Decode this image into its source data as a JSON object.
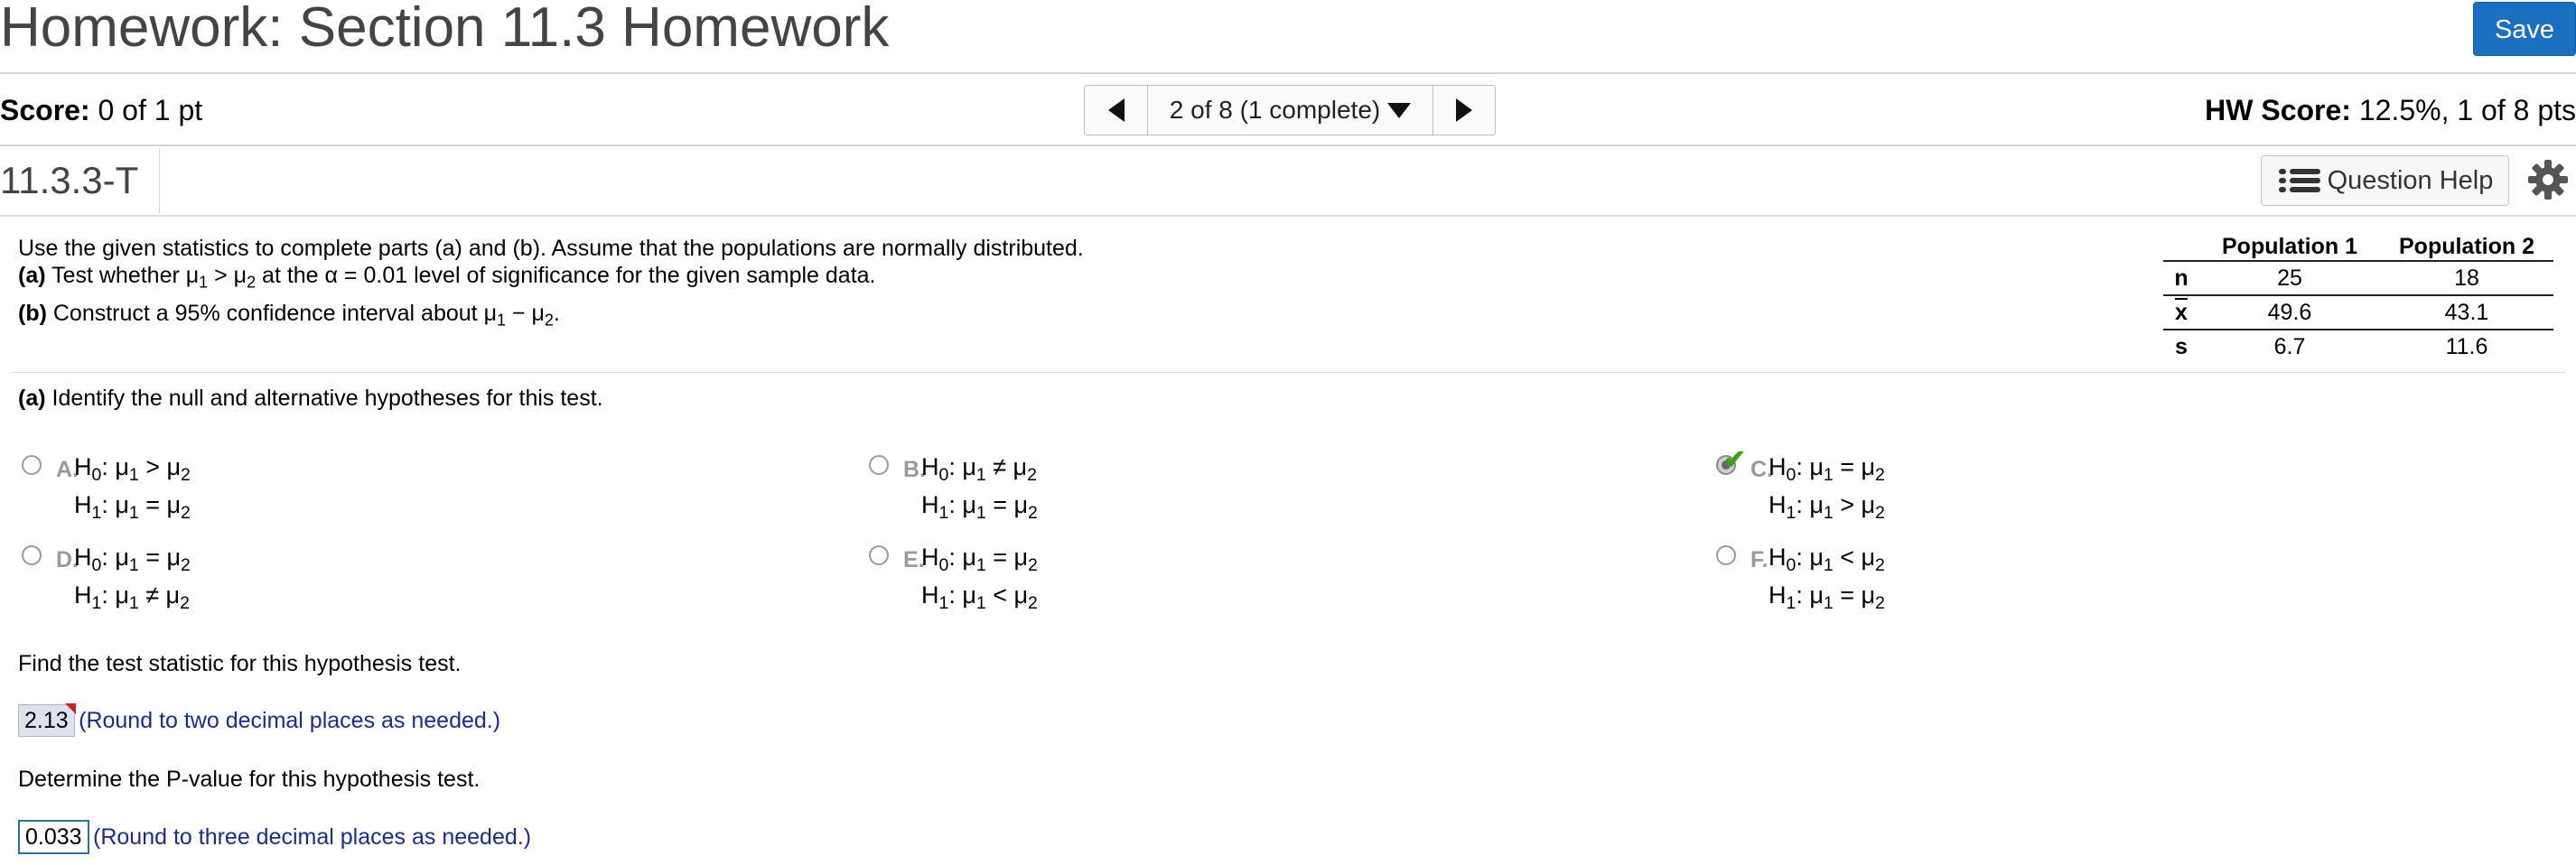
{
  "header": {
    "title": "Homework: Section 11.3 Homework",
    "save_label": "Save"
  },
  "score": {
    "label": "Score:",
    "value": "0 of 1 pt"
  },
  "nav": {
    "position": "2 of 8 (1 complete)"
  },
  "hw_score": {
    "label": "HW Score:",
    "value": "12.5%, 1 of 8 pts"
  },
  "question": {
    "id": "11.3.3-T",
    "help_label": "Question Help"
  },
  "problem": {
    "intro": "Use the given statistics to complete parts (a) and (b). Assume that the populations are normally distributed.",
    "part_a_label": "(a)",
    "part_a_pre": "Test whether ",
    "part_a_post": " at the α = 0.01 level of significance for the given sample data.",
    "part_b_label": "(b)",
    "part_b_pre": "Construct a 95% confidence interval about ",
    "part_b_post": "."
  },
  "stats_table": {
    "headers": [
      "",
      "Population 1",
      "Population 2"
    ],
    "rows": [
      {
        "label": "n",
        "p1": "25",
        "p2": "18"
      },
      {
        "label": "x",
        "p1": "49.6",
        "p2": "43.1"
      },
      {
        "label": "s",
        "p1": "6.7",
        "p2": "11.6"
      }
    ]
  },
  "part_a": {
    "label": "(a)",
    "question": "Identify the null and alternative hypotheses for this test.",
    "choices": [
      {
        "letter": "A.",
        "h0": "μ1 > μ2",
        "h1": "μ1 = μ2"
      },
      {
        "letter": "B.",
        "h0": "μ1 ≠ μ2",
        "h1": "μ1 = μ2"
      },
      {
        "letter": "C.",
        "h0": "μ1 = μ2",
        "h1": "μ1 > μ2",
        "selected": true
      },
      {
        "letter": "D.",
        "h0": "μ1 = μ2",
        "h1": "μ1 ≠ μ2"
      },
      {
        "letter": "E.",
        "h0": "μ1 = μ2",
        "h1": "μ1 < μ2"
      },
      {
        "letter": "F.",
        "h0": "μ1 < μ2",
        "h1": "μ1 = μ2"
      }
    ]
  },
  "test_statistic": {
    "prompt": "Find the test statistic for this hypothesis test.",
    "value": "2.13",
    "hint": "(Round to two decimal places as needed.)"
  },
  "p_value": {
    "prompt": "Determine the P-value for this hypothesis test.",
    "value": "0.033",
    "hint": "(Round to three decimal places as needed.)"
  },
  "colors": {
    "accent": "#1a6fc1",
    "hint_text": "#1a2c8c",
    "correct_check": "#3aa017",
    "incorrect_flag": "#d32020"
  }
}
